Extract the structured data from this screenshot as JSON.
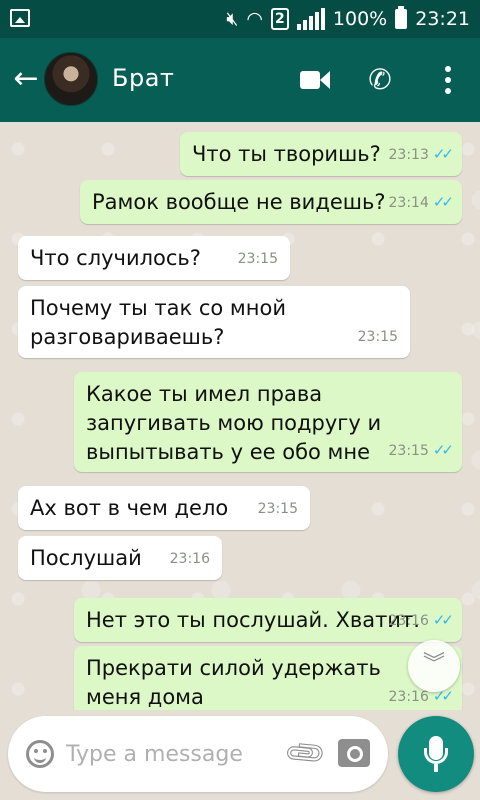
{
  "status_bar": {
    "sim_slot": "2",
    "battery": "100%",
    "time": "23:21",
    "icons": [
      "gallery-icon",
      "mute-icon",
      "wifi-icon",
      "signal-icon",
      "battery-icon"
    ]
  },
  "toolbar": {
    "contact_name": "Брат",
    "icons": [
      "back-arrow-icon",
      "video-call-icon",
      "phone-icon",
      "more-vert-icon"
    ]
  },
  "messages": [
    {
      "direction": "out",
      "text": "Что ты творишь?",
      "time": "23:13",
      "ticks": "✓✓"
    },
    {
      "direction": "out",
      "text": "Рамок вообще не видешь?",
      "time": "23:14",
      "ticks": "✓✓"
    },
    {
      "direction": "in",
      "text": "Что случилось?",
      "time": "23:15"
    },
    {
      "direction": "in",
      "text": "Почему ты так со мной разговариваешь?",
      "time": "23:15"
    },
    {
      "direction": "out",
      "text": "Какое ты имел права запугивать мою подругу и выпытывать у ее обо мне",
      "time": "23:15",
      "ticks": "✓✓"
    },
    {
      "direction": "in",
      "text": "Ах вот в чем дело",
      "time": "23:15"
    },
    {
      "direction": "in",
      "text": "Послушай",
      "time": "23:16"
    },
    {
      "direction": "out",
      "text": "Нет это ты послушай. Хватит.",
      "time": "23:16",
      "ticks": "✓✓"
    },
    {
      "direction": "out",
      "text": "Прекрати силой удержать меня дома",
      "time": "23:16",
      "ticks": "✓✓"
    }
  ],
  "composer": {
    "placeholder": "Type a message",
    "icons": [
      "emoji-icon",
      "attach-icon",
      "camera-icon",
      "mic-icon"
    ]
  },
  "colors": {
    "status_bar": "#054d44",
    "toolbar": "#075e54",
    "outgoing_bubble": "#dcf8c6",
    "incoming_bubble": "#ffffff",
    "read_ticks": "#34b7f1",
    "mic_button": "#128c7e"
  }
}
